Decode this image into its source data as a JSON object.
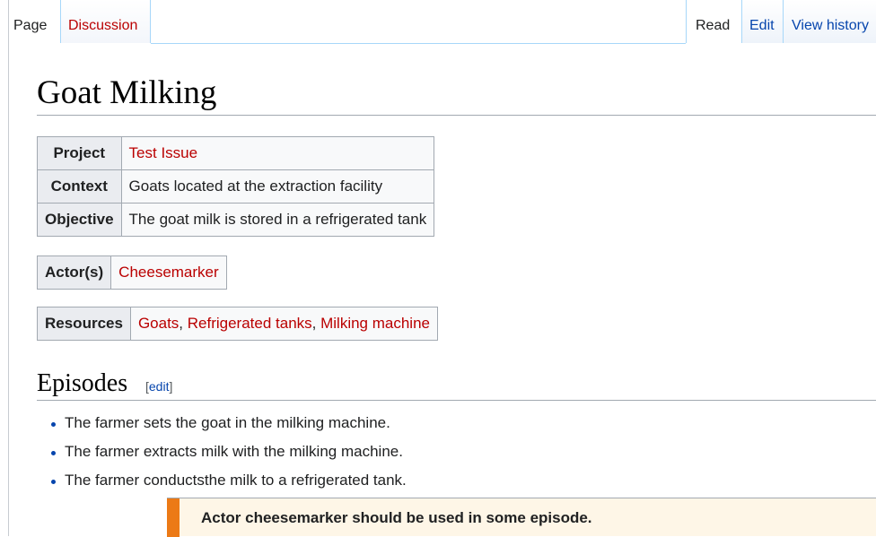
{
  "tabs": {
    "page": "Page",
    "discussion": "Discussion",
    "read": "Read",
    "edit": "Edit",
    "view_history": "View history"
  },
  "page_title": "Goat Milking",
  "project_table": {
    "rows": [
      {
        "label": "Project",
        "value": "Test Issue"
      },
      {
        "label": "Context",
        "value": "Goats located at the extraction facility"
      },
      {
        "label": "Objective",
        "value": "The goat milk is stored in a refrigerated tank"
      }
    ]
  },
  "actor_table": {
    "label": "Actor(s)",
    "value": "Cheesemarker"
  },
  "resources_table": {
    "label": "Resources",
    "items": [
      "Goats",
      "Refrigerated tanks",
      "Milking machine"
    ],
    "separator": ", "
  },
  "episodes": {
    "heading": "Episodes",
    "edit_open": "[",
    "edit_label": "edit",
    "edit_close": "]",
    "items": [
      "The farmer sets the goat in the milking machine.",
      "The farmer extracts milk with the milking machine.",
      "The farmer conductsthe milk to a refrigerated tank."
    ]
  },
  "warning": {
    "text": "Actor cheesemarker should be used in some episode."
  },
  "colors": {
    "link": "#0645ad",
    "redlink": "#ba0000",
    "warning_accent": "#ec7a16",
    "warning_bg": "#fef6e7"
  }
}
